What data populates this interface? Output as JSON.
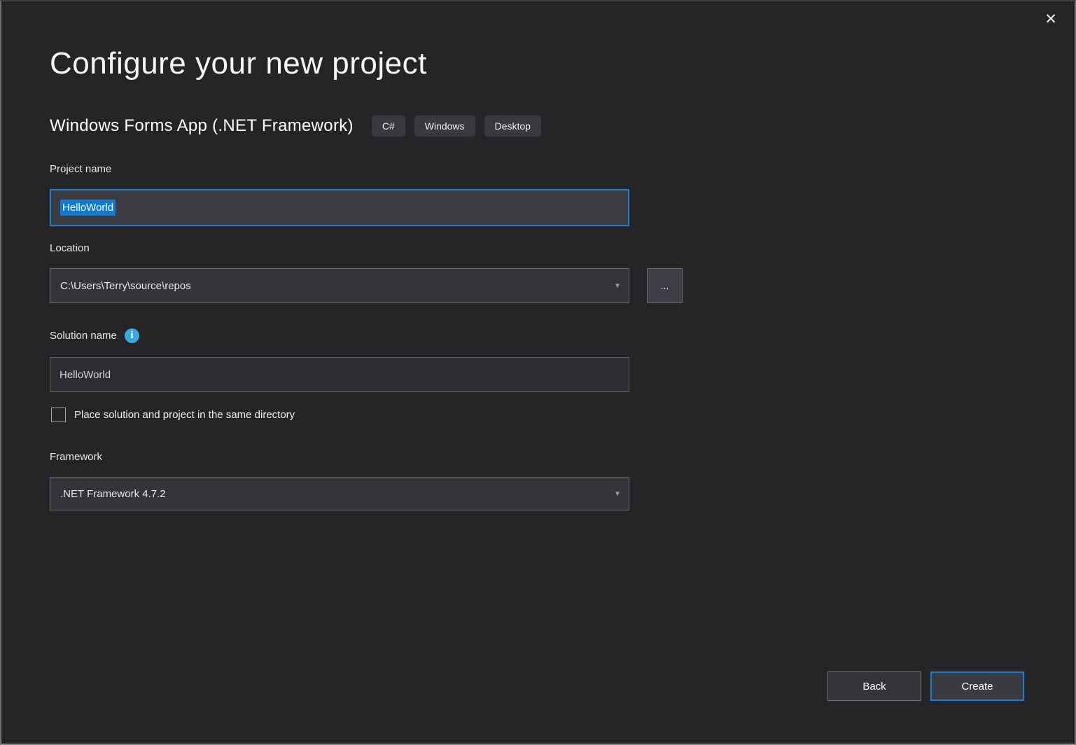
{
  "window": {
    "title": "Configure your new project",
    "icons": {
      "close": "✕",
      "dropdown": "▾",
      "info": "i"
    }
  },
  "template": {
    "name": "Windows Forms App (.NET Framework)",
    "tags": [
      "C#",
      "Windows",
      "Desktop"
    ]
  },
  "form": {
    "project_name": {
      "label": "Project name",
      "value": "HelloWorld",
      "selected": true
    },
    "location": {
      "label": "Location",
      "value": "C:\\Users\\Terry\\source\\repos",
      "browse_label": "..."
    },
    "solution_name": {
      "label": "Solution name",
      "value": "HelloWorld"
    },
    "same_directory": {
      "label": "Place solution and project in the same directory",
      "checked": false
    },
    "framework": {
      "label": "Framework",
      "value": ".NET Framework 4.7.2"
    }
  },
  "footer": {
    "back_label": "Back",
    "create_label": "Create"
  },
  "colors": {
    "accent_blue": "#1a7fd4",
    "selection_blue": "#0e7ad3",
    "info_icon_blue": "#38a9e0",
    "dialog_background": "#252527"
  }
}
